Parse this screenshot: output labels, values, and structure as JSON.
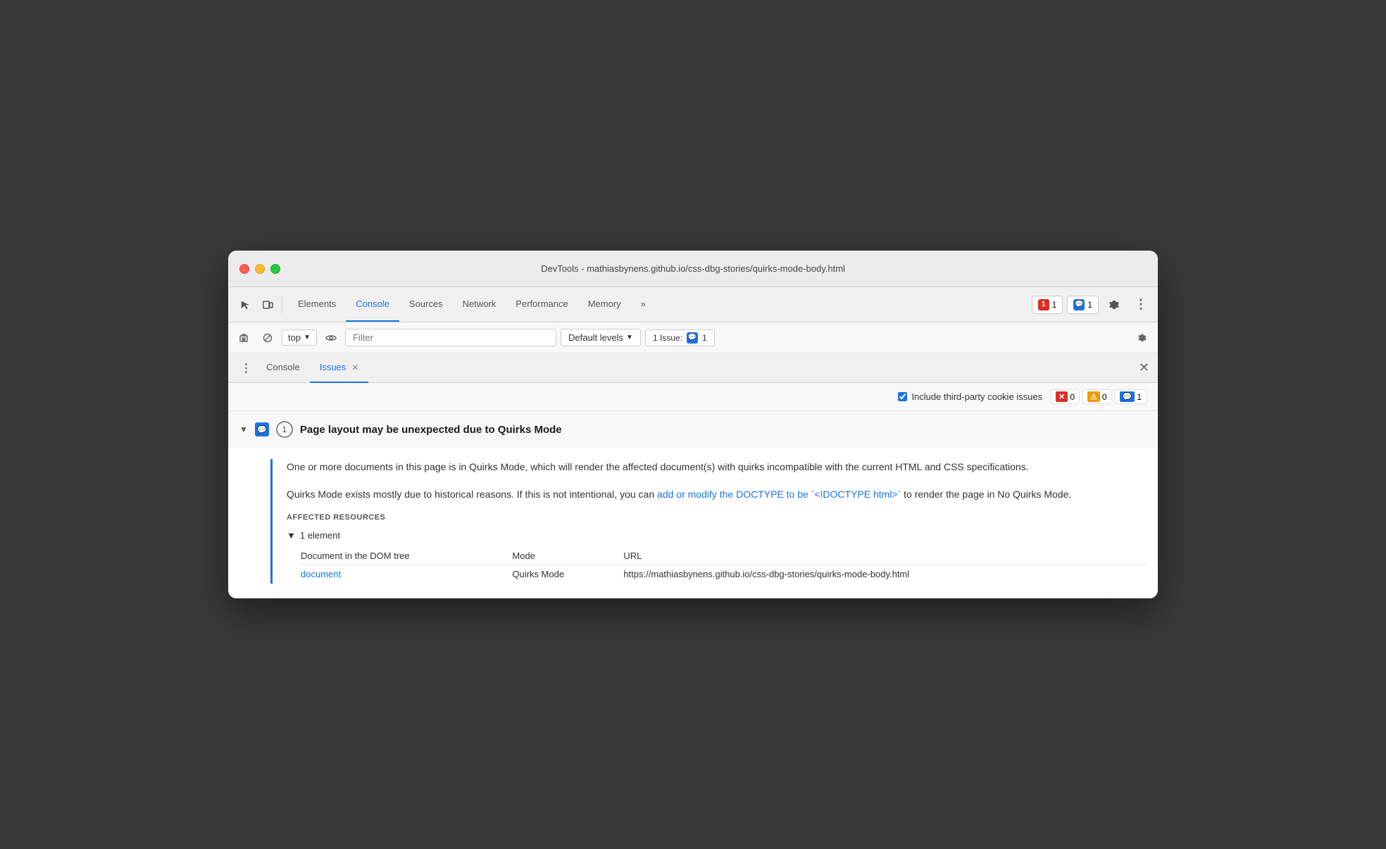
{
  "window": {
    "title": "DevTools - mathiasbynens.github.io/css-dbg-stories/quirks-mode-body.html"
  },
  "toolbar": {
    "tabs": [
      {
        "id": "elements",
        "label": "Elements",
        "active": false
      },
      {
        "id": "console",
        "label": "Console",
        "active": true
      },
      {
        "id": "sources",
        "label": "Sources",
        "active": false
      },
      {
        "id": "network",
        "label": "Network",
        "active": false
      },
      {
        "id": "performance",
        "label": "Performance",
        "active": false
      },
      {
        "id": "memory",
        "label": "Memory",
        "active": false
      },
      {
        "id": "more",
        "label": "»",
        "active": false
      }
    ],
    "error_count": "1",
    "message_count": "1"
  },
  "console_toolbar": {
    "top_label": "top",
    "filter_placeholder": "Filter",
    "default_levels_label": "Default levels",
    "issue_label": "1 Issue:",
    "issue_count": "1"
  },
  "panel": {
    "console_tab_label": "Console",
    "issues_tab_label": "Issues",
    "include_third_party_label": "Include third-party cookie issues",
    "error_count": "0",
    "warning_count": "0",
    "info_count": "1"
  },
  "issue": {
    "title": "Page layout may be unexpected due to Quirks Mode",
    "count": "1",
    "description1": "One or more documents in this page is in Quirks Mode, which will render the affected document(s) with quirks incompatible with the current HTML and CSS specifications.",
    "description2_before": "Quirks Mode exists mostly due to historical reasons. If this is not intentional, you can ",
    "description2_link": "add or modify the DOCTYPE to be `<!DOCTYPE html>`",
    "description2_after": " to render the page in No Quirks Mode.",
    "affected_resources_label": "AFFECTED RESOURCES",
    "element_count_label": "1 element",
    "col_document": "Document in the DOM tree",
    "col_mode": "Mode",
    "col_url": "URL",
    "resource_link": "document",
    "resource_mode": "Quirks Mode",
    "resource_url": "https://mathiasbynens.github.io/css-dbg-stories/quirks-mode-body.html"
  }
}
